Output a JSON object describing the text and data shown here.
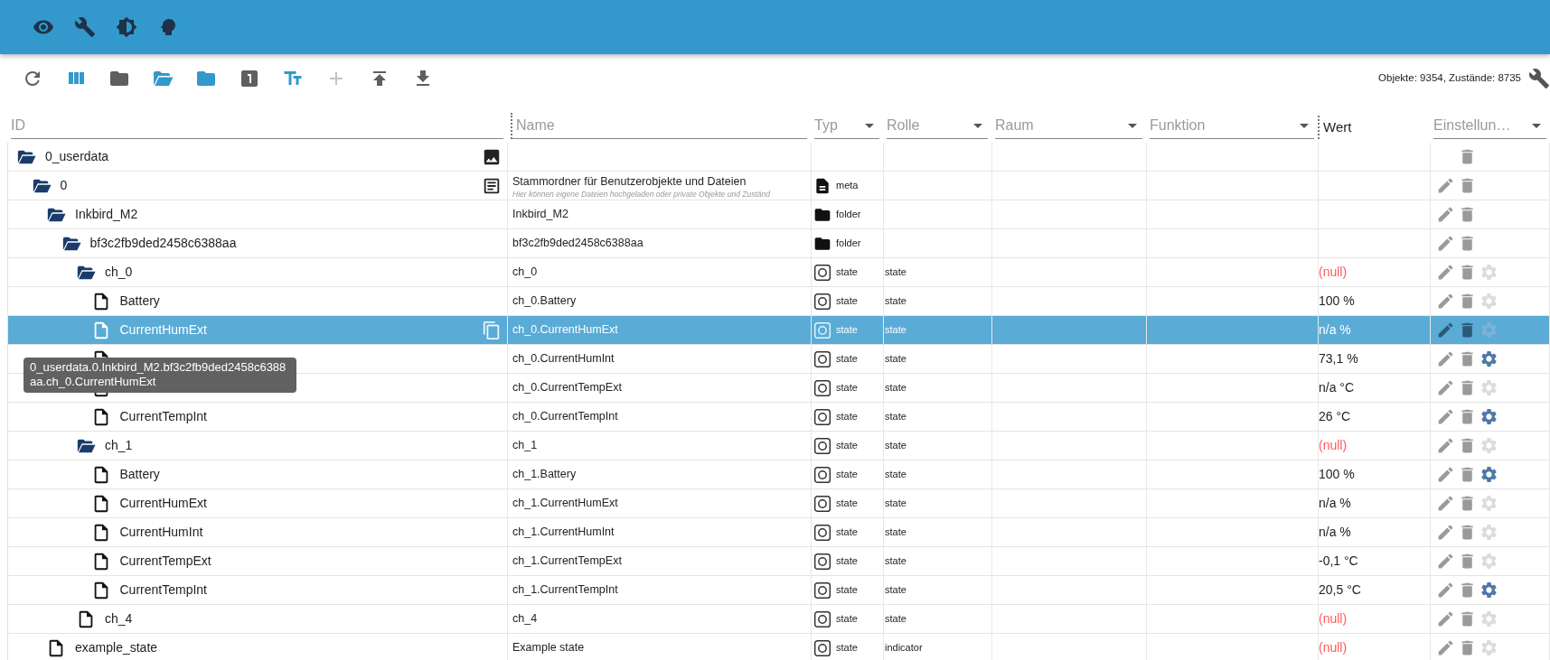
{
  "toolbar": {
    "buttons": [
      {
        "kind": "reload",
        "active": false,
        "disabled": false
      },
      {
        "kind": "columns",
        "active": true,
        "disabled": false
      },
      {
        "kind": "folder",
        "active": false,
        "disabled": false
      },
      {
        "kind": "folder-open",
        "active": true,
        "disabled": false
      },
      {
        "kind": "folder",
        "active": true,
        "disabled": false
      },
      {
        "kind": "one",
        "active": false,
        "disabled": false
      },
      {
        "kind": "text-size",
        "active": true,
        "disabled": false
      },
      {
        "kind": "add",
        "active": false,
        "disabled": true
      },
      {
        "kind": "upload",
        "active": false,
        "disabled": false
      },
      {
        "kind": "download",
        "active": false,
        "disabled": false
      }
    ],
    "stats": "Objekte: 9354, Zustände: 8735"
  },
  "columns": [
    {
      "kind": "input",
      "placeholder": "ID"
    },
    {
      "kind": "input",
      "placeholder": "Name"
    },
    {
      "kind": "select",
      "placeholder": "Typ"
    },
    {
      "kind": "select",
      "placeholder": "Rolle"
    },
    {
      "kind": "select",
      "placeholder": "Raum"
    },
    {
      "kind": "select",
      "placeholder": "Funktion"
    },
    {
      "kind": "label",
      "label": "Wert"
    },
    {
      "kind": "select",
      "placeholder": "Einstellun…"
    }
  ],
  "rows": [
    {
      "id": "0_userdata",
      "kind": "folder",
      "expanded": true,
      "selected": false,
      "id_button": {
        "kind": "image"
      },
      "edit": false,
      "children": [
        {
          "id": "0",
          "kind": "folder",
          "expanded": true,
          "selected": false,
          "id_button": {
            "kind": "text"
          },
          "name": "Stammordner für Benutzerobjekte und Dateien",
          "description": "Hier können eigene Dateien hochgeladen oder private Objekte und Zuständ",
          "type_badge": {
            "kind": "meta",
            "label": "meta"
          },
          "edit": true,
          "children": [
            {
              "id": "Inkbird_M2",
              "kind": "folder",
              "expanded": true,
              "selected": false,
              "name": "Inkbird_M2",
              "type_badge": {
                "kind": "folder",
                "label": "folder"
              },
              "edit": true,
              "children": [
                {
                  "id": "bf3c2fb9ded2458c6388aa",
                  "kind": "folder",
                  "expanded": true,
                  "selected": false,
                  "name": "bf3c2fb9ded2458c6388aa",
                  "type_badge": {
                    "kind": "folder",
                    "label": "folder"
                  },
                  "edit": true,
                  "children": [
                    {
                      "id": "ch_0",
                      "kind": "folder",
                      "expanded": true,
                      "selected": false,
                      "name": "ch_0",
                      "type_badge": {
                        "kind": "state",
                        "label": "state"
                      },
                      "role": "state",
                      "value": "(null)",
                      "is_null": true,
                      "edit": true,
                      "settings": {
                        "on": false
                      },
                      "children": [
                        {
                          "id": "Battery",
                          "kind": "file",
                          "selected": false,
                          "name": "ch_0.Battery",
                          "type_badge": {
                            "kind": "state",
                            "label": "state"
                          },
                          "role": "state",
                          "value": "100 %",
                          "is_null": false,
                          "edit": true,
                          "settings": {
                            "on": false
                          }
                        },
                        {
                          "id": "CurrentHumExt",
                          "kind": "file",
                          "selected": true,
                          "id_button": {
                            "kind": "copy"
                          },
                          "name": "ch_0.CurrentHumExt",
                          "type_badge": {
                            "kind": "state",
                            "label": "state"
                          },
                          "role": "state",
                          "value": "n/a %",
                          "is_null": false,
                          "edit": true,
                          "settings": {
                            "on": false
                          }
                        },
                        {
                          "kind": "file",
                          "selected": false,
                          "name": "ch_0.CurrentHumInt",
                          "type_badge": {
                            "kind": "state",
                            "label": "state"
                          },
                          "role": "state",
                          "value": "73,1 %",
                          "is_null": false,
                          "edit": true,
                          "settings": {
                            "on": true
                          }
                        },
                        {
                          "kind": "file",
                          "selected": false,
                          "name": "ch_0.CurrentTempExt",
                          "type_badge": {
                            "kind": "state",
                            "label": "state"
                          },
                          "role": "state",
                          "value": "n/a °C",
                          "is_null": false,
                          "edit": true,
                          "settings": {
                            "on": false
                          }
                        },
                        {
                          "id": "CurrentTempInt",
                          "kind": "file",
                          "selected": false,
                          "name": "ch_0.CurrentTempInt",
                          "type_badge": {
                            "kind": "state",
                            "label": "state"
                          },
                          "role": "state",
                          "value": "26 °C",
                          "is_null": false,
                          "edit": true,
                          "settings": {
                            "on": true
                          }
                        }
                      ]
                    },
                    {
                      "id": "ch_1",
                      "kind": "folder",
                      "expanded": true,
                      "selected": false,
                      "name": "ch_1",
                      "type_badge": {
                        "kind": "state",
                        "label": "state"
                      },
                      "role": "state",
                      "value": "(null)",
                      "is_null": true,
                      "edit": true,
                      "settings": {
                        "on": false
                      },
                      "children": [
                        {
                          "id": "Battery",
                          "kind": "file",
                          "selected": false,
                          "name": "ch_1.Battery",
                          "type_badge": {
                            "kind": "state",
                            "label": "state"
                          },
                          "role": "state",
                          "value": "100 %",
                          "is_null": false,
                          "edit": true,
                          "settings": {
                            "on": true
                          }
                        },
                        {
                          "id": "CurrentHumExt",
                          "kind": "file",
                          "selected": false,
                          "name": "ch_1.CurrentHumExt",
                          "type_badge": {
                            "kind": "state",
                            "label": "state"
                          },
                          "role": "state",
                          "value": "n/a %",
                          "is_null": false,
                          "edit": true,
                          "settings": {
                            "on": false
                          }
                        },
                        {
                          "id": "CurrentHumInt",
                          "kind": "file",
                          "selected": false,
                          "name": "ch_1.CurrentHumInt",
                          "type_badge": {
                            "kind": "state",
                            "label": "state"
                          },
                          "role": "state",
                          "value": "n/a %",
                          "is_null": false,
                          "edit": true,
                          "settings": {
                            "on": false
                          }
                        },
                        {
                          "id": "CurrentTempExt",
                          "kind": "file",
                          "selected": false,
                          "name": "ch_1.CurrentTempExt",
                          "type_badge": {
                            "kind": "state",
                            "label": "state"
                          },
                          "role": "state",
                          "value": "-0,1 °C",
                          "is_null": false,
                          "edit": true,
                          "settings": {
                            "on": false
                          }
                        },
                        {
                          "id": "CurrentTempInt",
                          "kind": "file",
                          "selected": false,
                          "name": "ch_1.CurrentTempInt",
                          "type_badge": {
                            "kind": "state",
                            "label": "state"
                          },
                          "role": "state",
                          "value": "20,5 °C",
                          "is_null": false,
                          "edit": true,
                          "settings": {
                            "on": true
                          }
                        }
                      ]
                    },
                    {
                      "id": "ch_4",
                      "kind": "file",
                      "selected": false,
                      "name": "ch_4",
                      "type_badge": {
                        "kind": "state",
                        "label": "state"
                      },
                      "role": "state",
                      "value": "(null)",
                      "is_null": true,
                      "edit": true,
                      "settings": {
                        "on": false
                      }
                    }
                  ]
                }
              ]
            },
            {
              "id": "example_state",
              "kind": "file",
              "selected": false,
              "name": "Example state",
              "type_badge": {
                "kind": "state",
                "label": "state"
              },
              "role": "indicator",
              "value": "(null)",
              "is_null": true,
              "edit": true,
              "settings": {
                "on": false
              }
            }
          ]
        }
      ]
    }
  ],
  "tooltip": {
    "text": "0_userdata.0.Inkbird_M2.bf3c2fb9ded2458c6388aa.ch_0.CurrentHumExt"
  }
}
